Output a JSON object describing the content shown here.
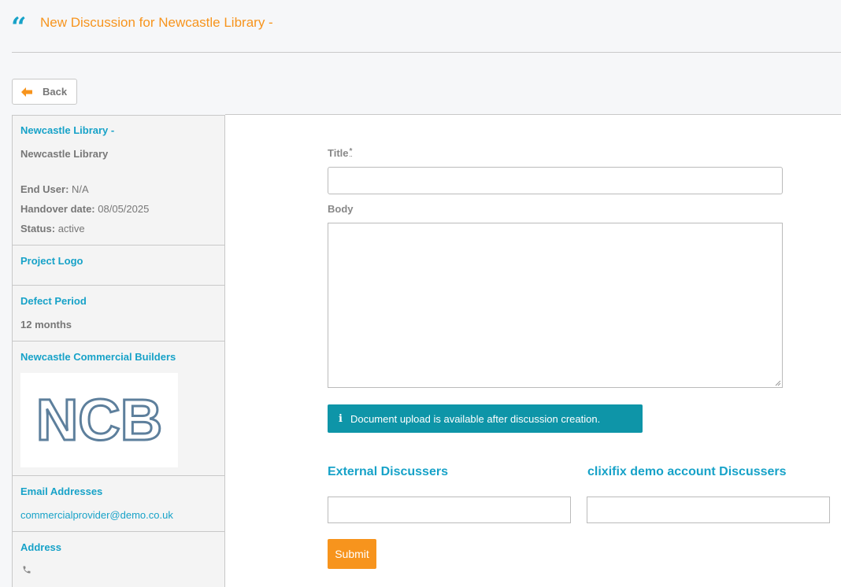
{
  "header": {
    "title": "New Discussion for Newcastle Library -"
  },
  "toolbar": {
    "back_label": "Back"
  },
  "sidebar": {
    "project": {
      "heading": "Newcastle Library -",
      "name": "Newcastle Library",
      "end_user_label": "End User:",
      "end_user_value": "N/A",
      "handover_label": "Handover date:",
      "handover_value": "08/05/2025",
      "status_label": "Status:",
      "status_value": "active"
    },
    "project_logo": {
      "heading": "Project Logo"
    },
    "defect_period": {
      "heading": "Defect Period",
      "value": "12 months"
    },
    "builder": {
      "heading": "Newcastle Commercial Builders",
      "logo_text": "NCB"
    },
    "email": {
      "heading": "Email Addresses",
      "value": "commercialprovider@demo.co.uk"
    },
    "address": {
      "heading": "Address",
      "phone_icon": "phone-icon"
    }
  },
  "form": {
    "title_label": "Title",
    "title_required_mark": "*",
    "title_value": "",
    "body_label": "Body",
    "body_value": "",
    "upload_notice": "Document upload is available after discussion creation.",
    "external_discussers_label": "External Discussers",
    "internal_discussers_label": "clixifix demo account Discussers",
    "submit_label": "Submit"
  },
  "colors": {
    "accent_orange": "#f7941d",
    "accent_blue": "#17a2c8",
    "alert_teal": "#0e95a8"
  }
}
